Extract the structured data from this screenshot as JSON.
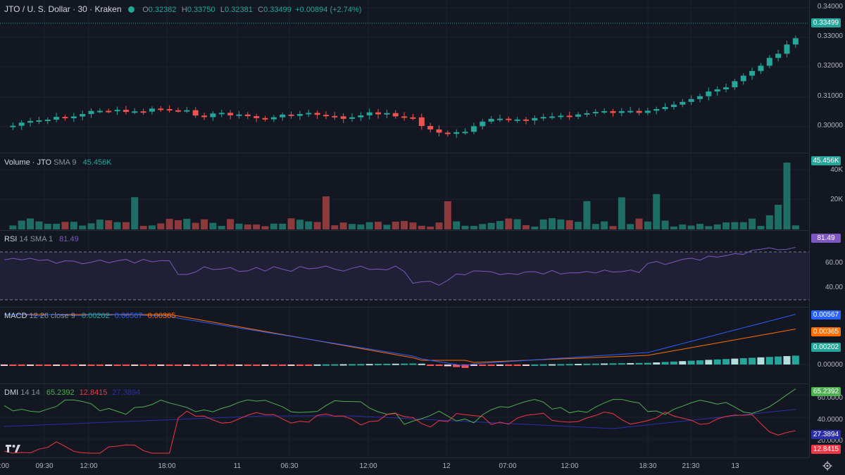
{
  "main_legend": {
    "title": "JTO / U. S. Dollar · 30 · Kraken",
    "o_label": "O",
    "o": "0.32382",
    "h_label": "H",
    "h": "0.33750",
    "l_label": "L",
    "l": "0.32381",
    "c_label": "C",
    "c": "0.33499",
    "change": "+0.00894 (+2.74%)"
  },
  "price_axis": [
    "0.34000",
    "0.33000",
    "0.32000",
    "0.31000",
    "0.30000"
  ],
  "price_badge": "0.33499",
  "volume": {
    "label": "Volume · JTO",
    "params": "SMA 9",
    "value": "45.456K",
    "axis": [
      "40K",
      "20K"
    ],
    "badge": "45.456K"
  },
  "rsi": {
    "label": "RSI",
    "params": "14 SMA 1",
    "value": "81.49",
    "axis": [
      "60.00",
      "40.00"
    ],
    "badge": "81.49"
  },
  "macd": {
    "label": "MACD",
    "params": "12 26 close 9",
    "v1": "0.00202",
    "v2": "0.00567",
    "v3": "0.00365",
    "axis": [
      "0.00000"
    ],
    "badges": [
      "0.00567",
      "0.00365",
      "0.00202"
    ]
  },
  "dmi": {
    "label": "DMI",
    "params": "14 14",
    "v1": "65.2392",
    "v2": "12.8415",
    "v3": "27.3894",
    "axis": [
      "60.0000",
      "40.0000",
      "20.0000"
    ],
    "badges": [
      "65.2392",
      "27.3894",
      "12.8415"
    ]
  },
  "time_axis": [
    ":00",
    "09:30",
    "12:00",
    "18:00",
    "11",
    "06:30",
    "12:00",
    "12",
    "07:00",
    "12:00",
    "18:30",
    "21:30",
    "13"
  ],
  "colors": {
    "up": "#26a69a",
    "down": "#ef5350",
    "bg": "#131722",
    "rsi": "#7e57c2",
    "macd": "#2962ff",
    "signal": "#ff6d00",
    "plus_di": "#4caf50",
    "minus_di": "#f23645",
    "adx": "#2a2fa8"
  },
  "icons": {
    "logo": "tradingview-logo-icon",
    "settings": "gear-icon",
    "visibility": "eye-dot-icon"
  }
}
